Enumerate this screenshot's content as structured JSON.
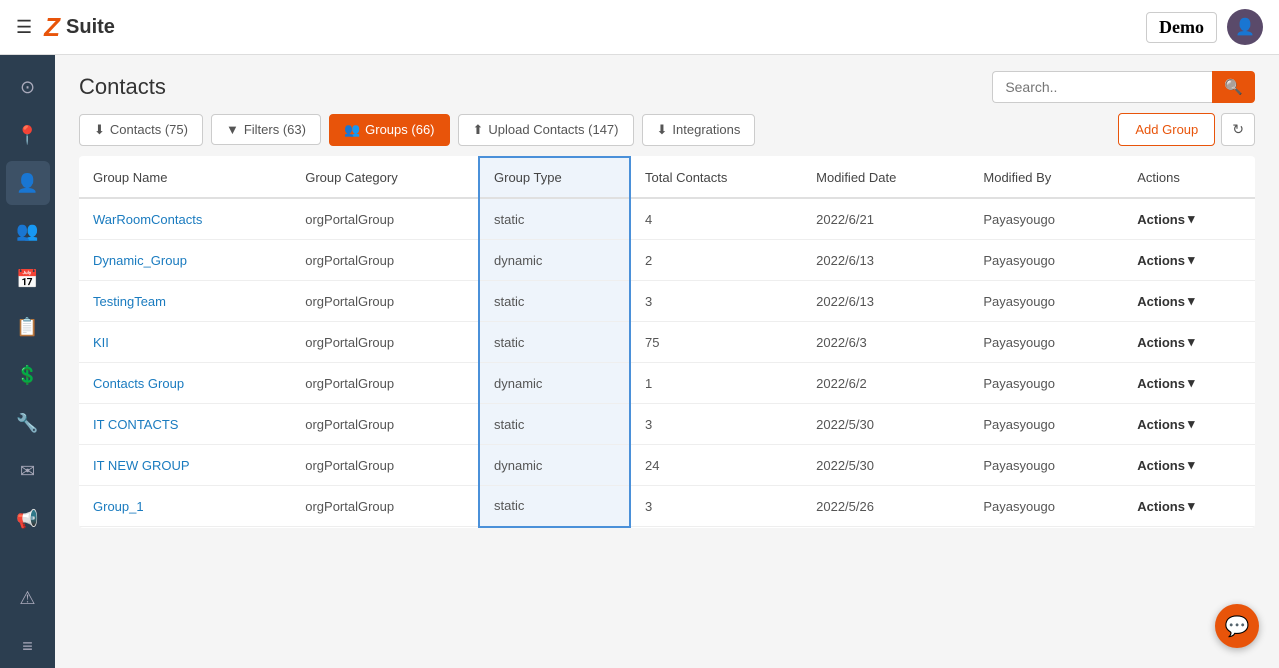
{
  "topbar": {
    "hamburger_icon": "☰",
    "logo_z": "Z",
    "logo_suite": "Suite",
    "demo_label": "Demo",
    "avatar_icon": "👤"
  },
  "search": {
    "placeholder": "Search..",
    "button_icon": "🔍"
  },
  "page": {
    "title": "Contacts"
  },
  "toolbar": {
    "contacts_label": "Contacts (75)",
    "filters_label": "Filters (63)",
    "groups_label": "Groups (66)",
    "upload_label": "Upload Contacts (147)",
    "integrations_label": "Integrations",
    "add_group_label": "Add Group",
    "refresh_icon": "↻"
  },
  "table": {
    "columns": [
      "Group Name",
      "Group Category",
      "Group Type",
      "Total Contacts",
      "Modified Date",
      "Modified By",
      "Actions"
    ],
    "rows": [
      {
        "name": "WarRoomContacts",
        "category": "orgPortalGroup",
        "type": "static",
        "total": "4",
        "date": "2022/6/21",
        "by": "Payasyougo",
        "actions": "Actions"
      },
      {
        "name": "Dynamic_Group",
        "category": "orgPortalGroup",
        "type": "dynamic",
        "total": "2",
        "date": "2022/6/13",
        "by": "Payasyougo",
        "actions": "Actions"
      },
      {
        "name": "TestingTeam",
        "category": "orgPortalGroup",
        "type": "static",
        "total": "3",
        "date": "2022/6/13",
        "by": "Payasyougo",
        "actions": "Actions"
      },
      {
        "name": "KII",
        "category": "orgPortalGroup",
        "type": "static",
        "total": "75",
        "date": "2022/6/3",
        "by": "Payasyougo",
        "actions": "Actions"
      },
      {
        "name": "Contacts Group",
        "category": "orgPortalGroup",
        "type": "dynamic",
        "total": "1",
        "date": "2022/6/2",
        "by": "Payasyougo",
        "actions": "Actions"
      },
      {
        "name": "IT CONTACTS",
        "category": "orgPortalGroup",
        "type": "static",
        "total": "3",
        "date": "2022/5/30",
        "by": "Payasyougo",
        "actions": "Actions"
      },
      {
        "name": "IT NEW GROUP",
        "category": "orgPortalGroup",
        "type": "dynamic",
        "total": "24",
        "date": "2022/5/30",
        "by": "Payasyougo",
        "actions": "Actions"
      },
      {
        "name": "Group_1",
        "category": "orgPortalGroup",
        "type": "static",
        "total": "3",
        "date": "2022/5/26",
        "by": "Payasyougo",
        "actions": "Actions"
      }
    ]
  },
  "sidebar": {
    "items": [
      {
        "icon": "⊙",
        "name": "dashboard"
      },
      {
        "icon": "📍",
        "name": "location"
      },
      {
        "icon": "👤",
        "name": "contacts"
      },
      {
        "icon": "👥",
        "name": "groups"
      },
      {
        "icon": "📅",
        "name": "calendar"
      },
      {
        "icon": "📋",
        "name": "reports"
      },
      {
        "icon": "💲",
        "name": "billing"
      },
      {
        "icon": "🔧",
        "name": "tools"
      },
      {
        "icon": "✉",
        "name": "mail"
      },
      {
        "icon": "📢",
        "name": "broadcast"
      },
      {
        "icon": "⚠",
        "name": "alerts"
      },
      {
        "icon": "≡",
        "name": "menu"
      }
    ]
  }
}
